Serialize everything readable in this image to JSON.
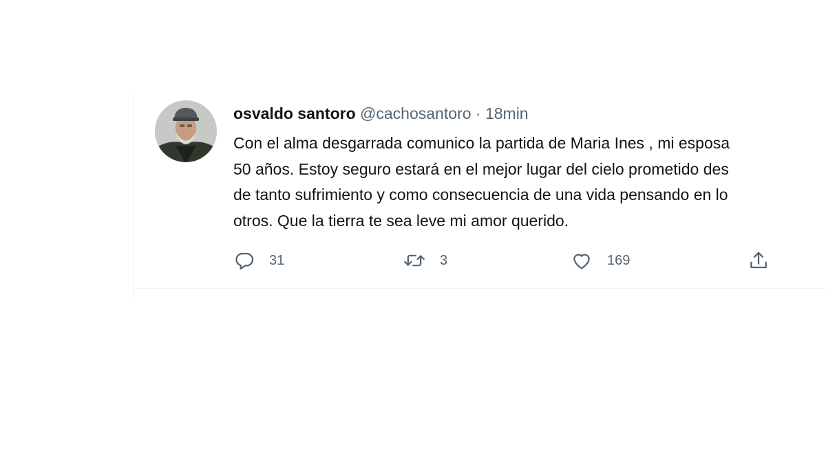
{
  "tweet": {
    "author": {
      "display_name": "osvaldo santoro",
      "handle": "@cachosantoro"
    },
    "separator": "·",
    "timestamp": "18min",
    "text_lines": [
      "Con el alma desgarrada comunico la partida de Maria Ines , mi esposa",
      "50 años. Estoy seguro estará en el mejor lugar del cielo prometido des",
      "de tanto sufrimiento y como consecuencia de una vida pensando en lo",
      "otros. Que la tierra te sea leve mi amor querido."
    ],
    "actions": {
      "reply": {
        "icon": "reply-icon",
        "count": "31"
      },
      "retweet": {
        "icon": "retweet-icon",
        "count": "3"
      },
      "like": {
        "icon": "heart-icon",
        "count": "169"
      },
      "share": {
        "icon": "share-icon"
      }
    }
  },
  "colors": {
    "text_primary": "#0f1419",
    "text_secondary": "#536471",
    "divider": "#eff3f4"
  }
}
